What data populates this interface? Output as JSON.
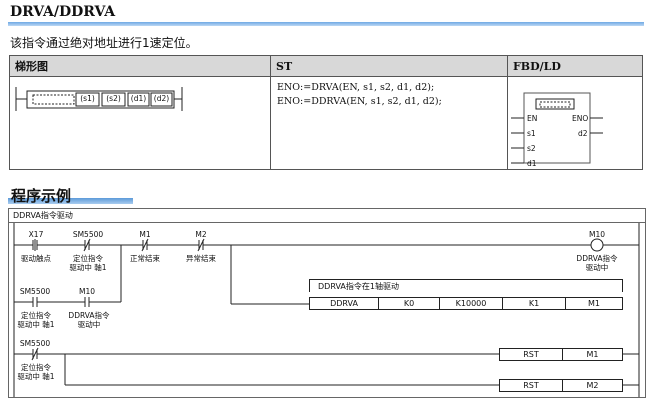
{
  "header": {
    "title": "DRVA/DDRVA",
    "description": "该指令通过绝对地址进行1速定位。"
  },
  "spec_table": {
    "headers": [
      "梯形图",
      "ST",
      "FBD/LD"
    ],
    "ladder_operands": [
      "(s1)",
      "(s2)",
      "(d1)",
      "(d2)"
    ],
    "st_lines": [
      "ENO:=DRVA(EN, s1, s2, d1, d2);",
      "ENO:=DDRVA(EN, s1, s2, d1, d2);"
    ],
    "fbd": {
      "en": "EN",
      "eno": "ENO",
      "inputs": [
        "s1",
        "s2",
        "d1"
      ],
      "outputs": [
        "d2"
      ]
    }
  },
  "example": {
    "title": "程序示例",
    "program_name": "DDRVA指令驱动",
    "contacts": [
      {
        "device": "X17",
        "comment": "驱动触点"
      },
      {
        "device": "SM5500",
        "comment": "定位指令\n驱动中 軸1"
      },
      {
        "device": "M1",
        "comment": "正常结束"
      },
      {
        "device": "M2",
        "comment": "异常结束"
      },
      {
        "device": "SM5500",
        "comment": "定位指令\n驱动中 軸1"
      },
      {
        "device": "M10",
        "comment": "DDRVA指令\n驱动中"
      },
      {
        "device": "SM5500",
        "comment": "定位指令\n驱动中 軸1"
      }
    ],
    "coil": {
      "device": "M10",
      "comment": "DDRVA指令\n驱动中"
    },
    "instruction_comment": "DDRVA指令在1轴驱动",
    "instruction": [
      "DDRVA",
      "K0",
      "K10000",
      "K1",
      "M1"
    ],
    "rst1": [
      "RST",
      "M1"
    ],
    "rst2": [
      "RST",
      "M2"
    ]
  }
}
